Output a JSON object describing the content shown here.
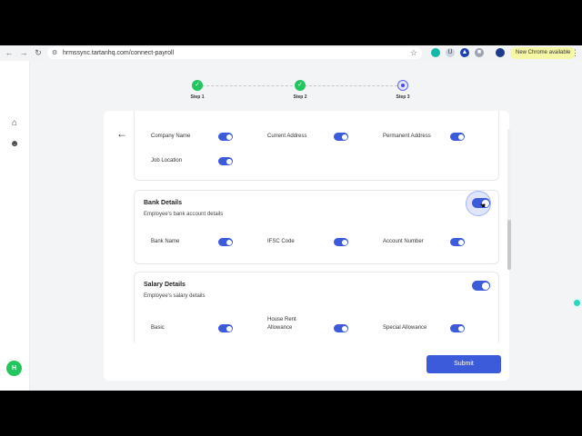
{
  "browser": {
    "url": "hrmssync.tartanhq.com/connect-payroll",
    "new_chrome_label": "New Chrome available",
    "icons": [
      "back-icon",
      "forward-icon",
      "reload-icon",
      "site-info-icon",
      "star-icon",
      "kebab-menu-icon"
    ]
  },
  "sidebar": {
    "avatar_initial": "H",
    "icons": [
      "home-icon",
      "users-icon"
    ]
  },
  "stepper": {
    "steps": [
      {
        "label": "Step 1",
        "state": "done"
      },
      {
        "label": "Step 2",
        "state": "done"
      },
      {
        "label": "Step 3",
        "state": "current"
      }
    ]
  },
  "sections": {
    "personal": {
      "fields": [
        {
          "label": "Company Name",
          "enabled": true
        },
        {
          "label": "Current Address",
          "enabled": true
        },
        {
          "label": "Permanent Address",
          "enabled": true
        },
        {
          "label": "Job Location",
          "enabled": true
        }
      ]
    },
    "bank": {
      "title": "Bank Details",
      "subtitle": "Employee's bank account details",
      "enabled": true,
      "fields": [
        {
          "label": "Bank Name",
          "enabled": true
        },
        {
          "label": "IFSC Code",
          "enabled": true
        },
        {
          "label": "Account Number",
          "enabled": true
        }
      ]
    },
    "salary": {
      "title": "Salary Details",
      "subtitle": "Employee's salary details",
      "enabled": true,
      "fields": [
        {
          "label": "Basic",
          "enabled": true
        },
        {
          "label": "House Rent",
          "label2": "Allowance",
          "enabled": true
        },
        {
          "label": "Special Allowance",
          "enabled": true
        }
      ]
    }
  },
  "actions": {
    "submit_label": "Submit"
  },
  "colors": {
    "accent": "#3b5bdb",
    "success": "#22c55e"
  }
}
